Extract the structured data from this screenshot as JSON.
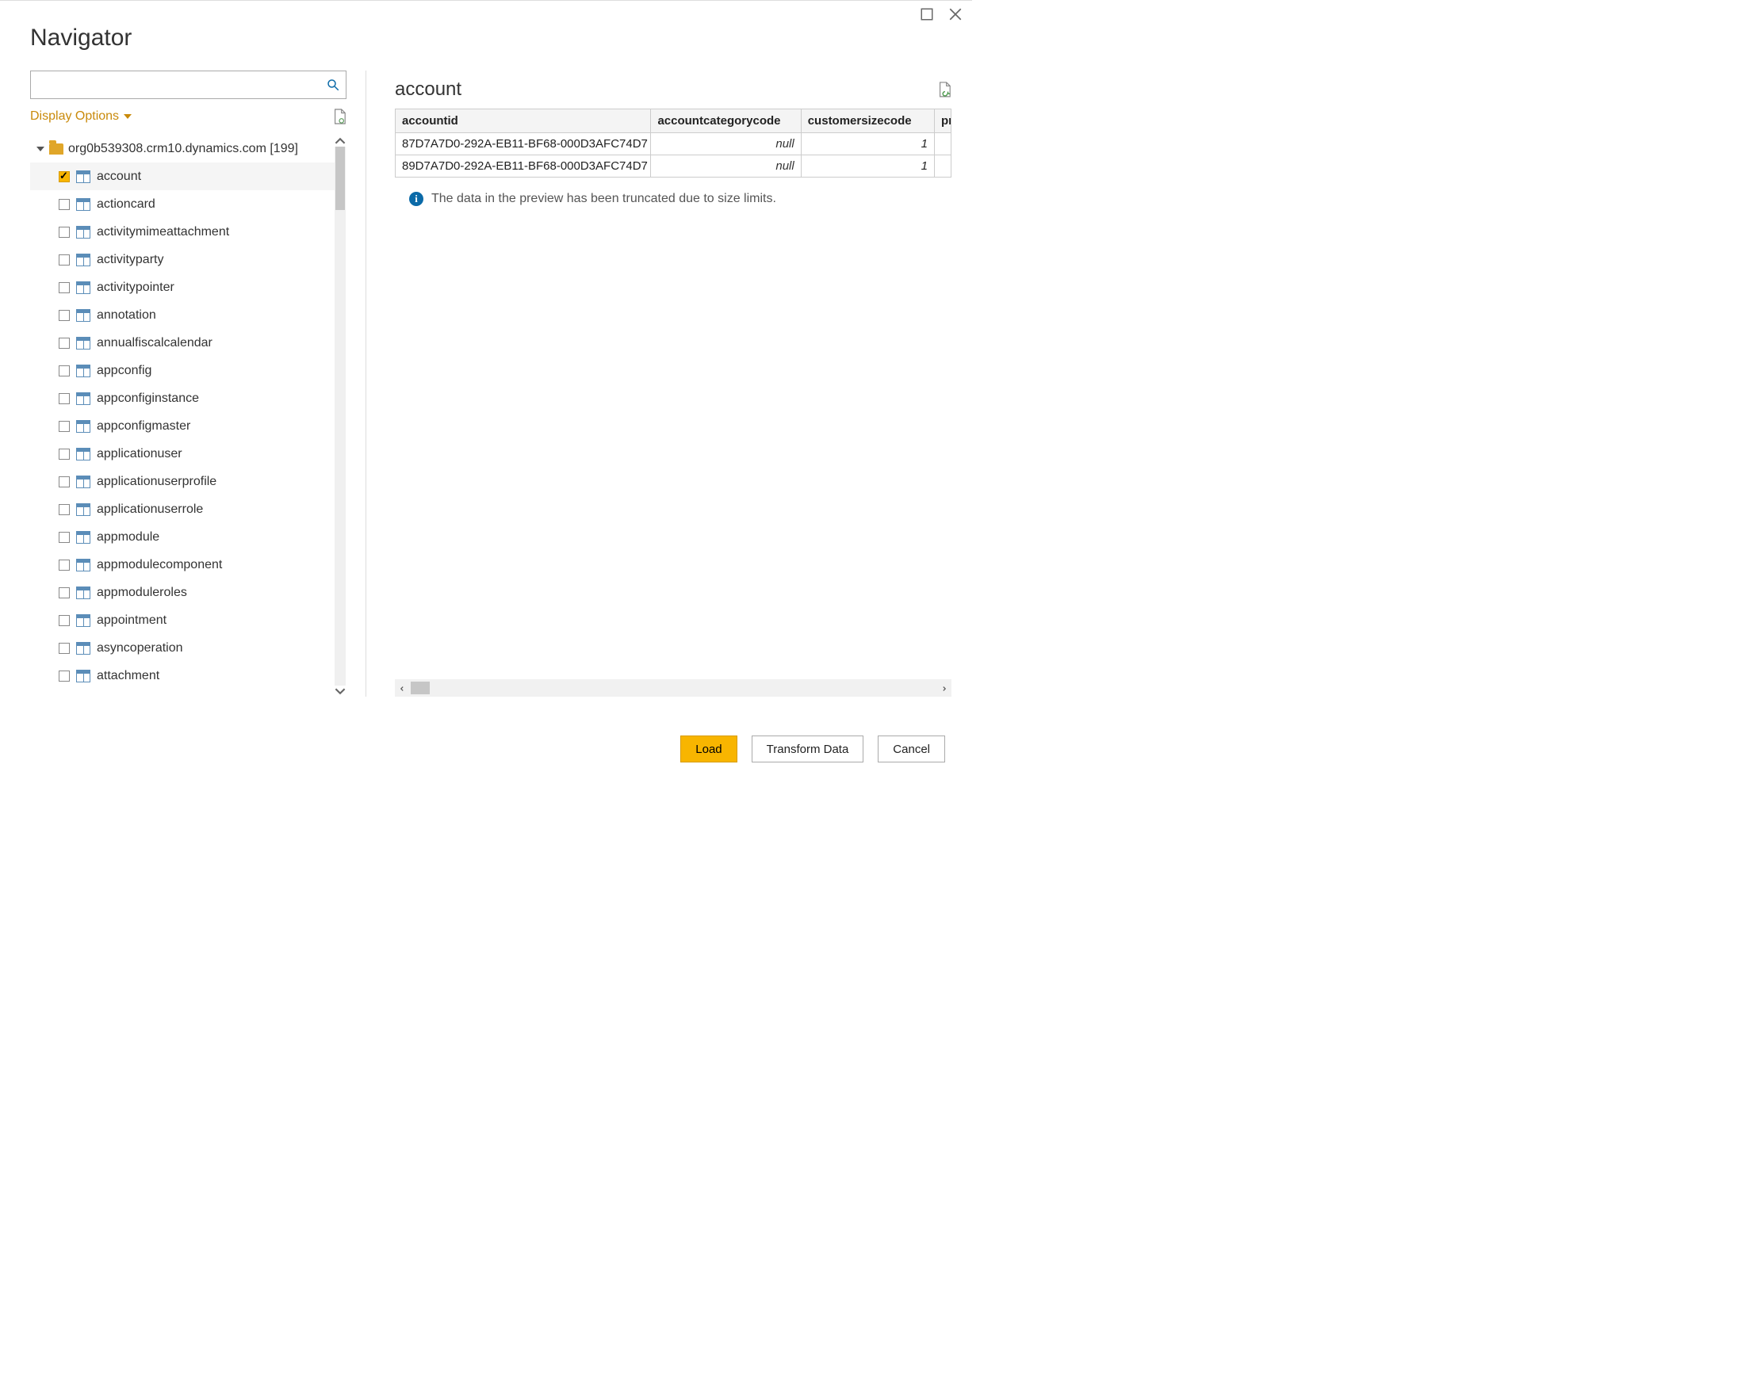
{
  "dialog": {
    "title": "Navigator"
  },
  "left": {
    "display_options_label": "Display Options",
    "root_label": "org0b539308.crm10.dynamics.com [199]",
    "items": [
      {
        "label": "account",
        "selected": true
      },
      {
        "label": "actioncard",
        "selected": false
      },
      {
        "label": "activitymimeattachment",
        "selected": false
      },
      {
        "label": "activityparty",
        "selected": false
      },
      {
        "label": "activitypointer",
        "selected": false
      },
      {
        "label": "annotation",
        "selected": false
      },
      {
        "label": "annualfiscalcalendar",
        "selected": false
      },
      {
        "label": "appconfig",
        "selected": false
      },
      {
        "label": "appconfiginstance",
        "selected": false
      },
      {
        "label": "appconfigmaster",
        "selected": false
      },
      {
        "label": "applicationuser",
        "selected": false
      },
      {
        "label": "applicationuserprofile",
        "selected": false
      },
      {
        "label": "applicationuserrole",
        "selected": false
      },
      {
        "label": "appmodule",
        "selected": false
      },
      {
        "label": "appmodulecomponent",
        "selected": false
      },
      {
        "label": "appmoduleroles",
        "selected": false
      },
      {
        "label": "appointment",
        "selected": false
      },
      {
        "label": "asyncoperation",
        "selected": false
      },
      {
        "label": "attachment",
        "selected": false
      }
    ]
  },
  "preview": {
    "title": "account",
    "columns": [
      "accountid",
      "accountcategorycode",
      "customersizecode",
      "pr"
    ],
    "rows": [
      {
        "accountid": "87D7A7D0-292A-EB11-BF68-000D3AFC74D7",
        "accountcategorycode": "null",
        "customersizecode": "1"
      },
      {
        "accountid": "89D7A7D0-292A-EB11-BF68-000D3AFC74D7",
        "accountcategorycode": "null",
        "customersizecode": "1"
      }
    ],
    "info_message": "The data in the preview has been truncated due to size limits."
  },
  "footer": {
    "load_label": "Load",
    "transform_label": "Transform Data",
    "cancel_label": "Cancel"
  }
}
